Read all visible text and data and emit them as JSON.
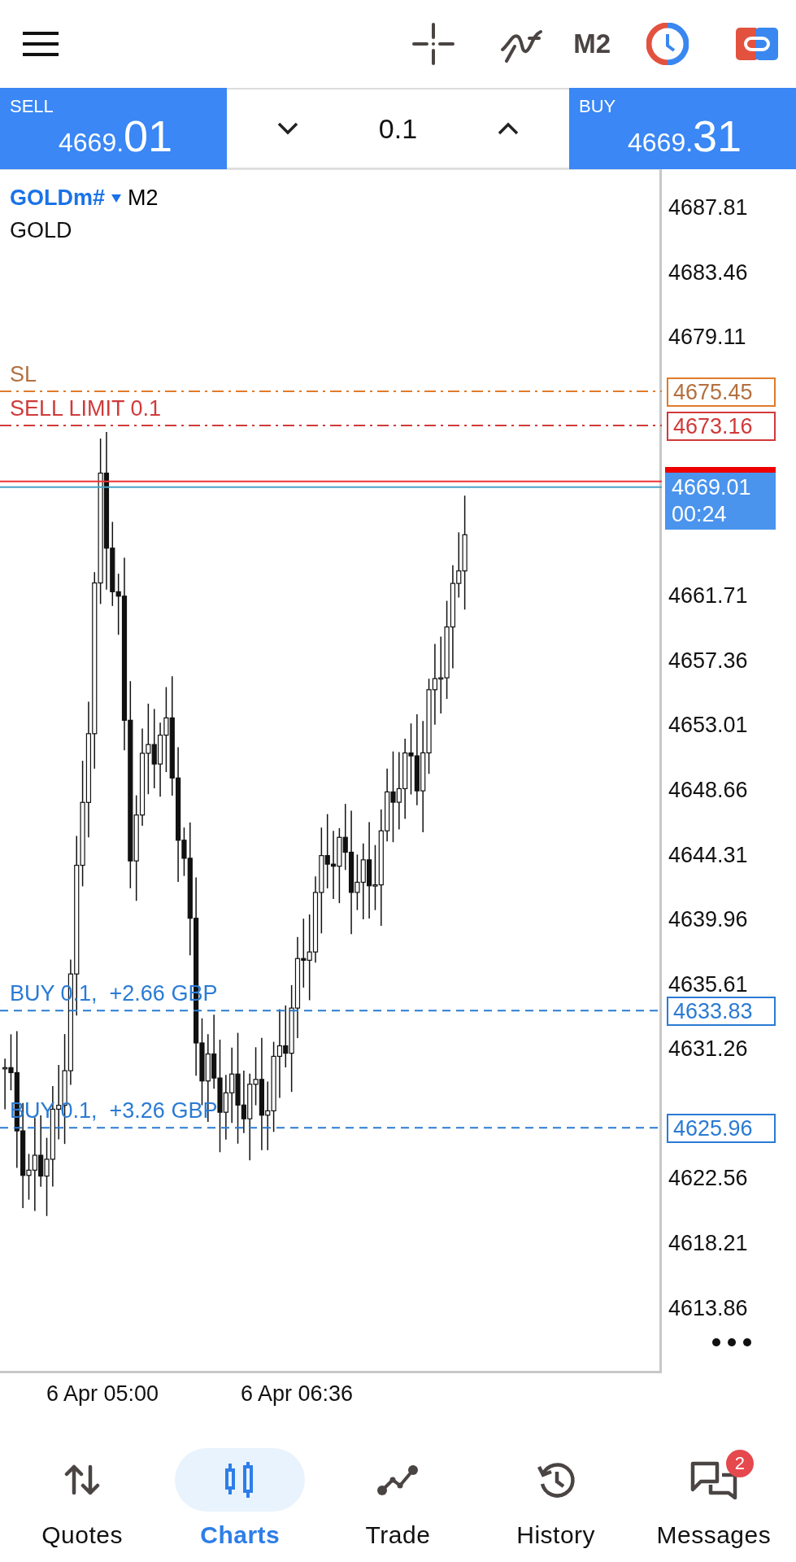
{
  "toolbar": {
    "timeframe": "M2"
  },
  "trade_panel": {
    "sell": {
      "label": "SELL",
      "price_main": "4669.",
      "price_big": "01"
    },
    "volume": "0.1",
    "buy": {
      "label": "BUY",
      "price_main": "4669.",
      "price_big": "31"
    }
  },
  "chart": {
    "symbol": "GOLDm#",
    "timeframe": "M2",
    "description": "GOLD",
    "price_axis": [
      "4687.81",
      "4683.46",
      "4679.11",
      "4661.71",
      "4657.36",
      "4653.01",
      "4648.66",
      "4644.31",
      "4639.96",
      "4635.61",
      "4631.26",
      "4622.56",
      "4618.21",
      "4613.86"
    ],
    "levels": [
      {
        "kind": "stop_loss",
        "label": "SL",
        "price": "4675.45",
        "color": "#e07b2a"
      },
      {
        "kind": "pending_order",
        "label": "SELL LIMIT 0.1",
        "price": "4673.16",
        "color": "#d03a3a"
      },
      {
        "kind": "position",
        "label": "BUY 0.1,  +2.66 GBP",
        "price": "4633.83",
        "color": "#2a7bd4"
      },
      {
        "kind": "position",
        "label": "BUY 0.1,  +3.26 GBP",
        "price": "4625.96",
        "color": "#2a7bd4"
      }
    ],
    "current_price": {
      "price": "4669.01",
      "timer": "00:24"
    },
    "time_axis": [
      "6 Apr 05:00",
      "6 Apr 06:36"
    ]
  },
  "nav": {
    "items": [
      {
        "kind": "quotes",
        "label": "Quotes",
        "selected": false
      },
      {
        "kind": "charts",
        "label": "Charts",
        "selected": true
      },
      {
        "kind": "trade",
        "label": "Trade",
        "selected": false
      },
      {
        "kind": "history",
        "label": "History",
        "selected": false
      },
      {
        "kind": "messages",
        "label": "Messages",
        "selected": false,
        "badge": "2"
      }
    ]
  }
}
